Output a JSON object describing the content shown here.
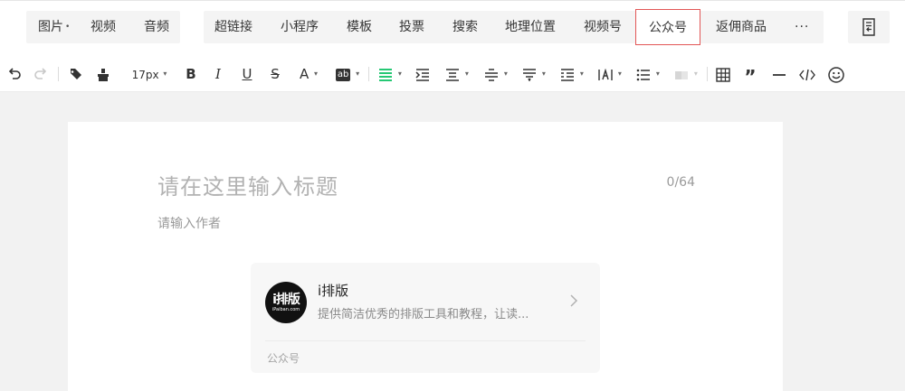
{
  "menubar": {
    "group1": [
      {
        "label": "图片",
        "has_caret": true
      },
      {
        "label": "视频"
      },
      {
        "label": "音频"
      }
    ],
    "group2": [
      {
        "label": "超链接"
      },
      {
        "label": "小程序"
      },
      {
        "label": "模板"
      },
      {
        "label": "投票"
      },
      {
        "label": "搜索"
      },
      {
        "label": "地理位置"
      },
      {
        "label": "视频号"
      },
      {
        "label": "公众号",
        "active": true
      },
      {
        "label": "返佣商品"
      },
      {
        "label": "···"
      }
    ],
    "side_icon": "document-return-icon"
  },
  "toolbar": {
    "font_size": "17px",
    "caret": "▾",
    "bold": "B",
    "italic": "I",
    "underline": "U",
    "strike": "S",
    "font_color": "A",
    "highlight": "ab",
    "accent_color": "#07c160"
  },
  "editor": {
    "title_placeholder": "请在这里输入标题",
    "title_count": "0/64",
    "author_placeholder": "请输入作者"
  },
  "card": {
    "logo_text": "i排版",
    "logo_subtext": "iPaiban.com",
    "name": "i排版",
    "description": "提供简洁优秀的排版工具和教程，让读...",
    "type_label": "公众号"
  }
}
